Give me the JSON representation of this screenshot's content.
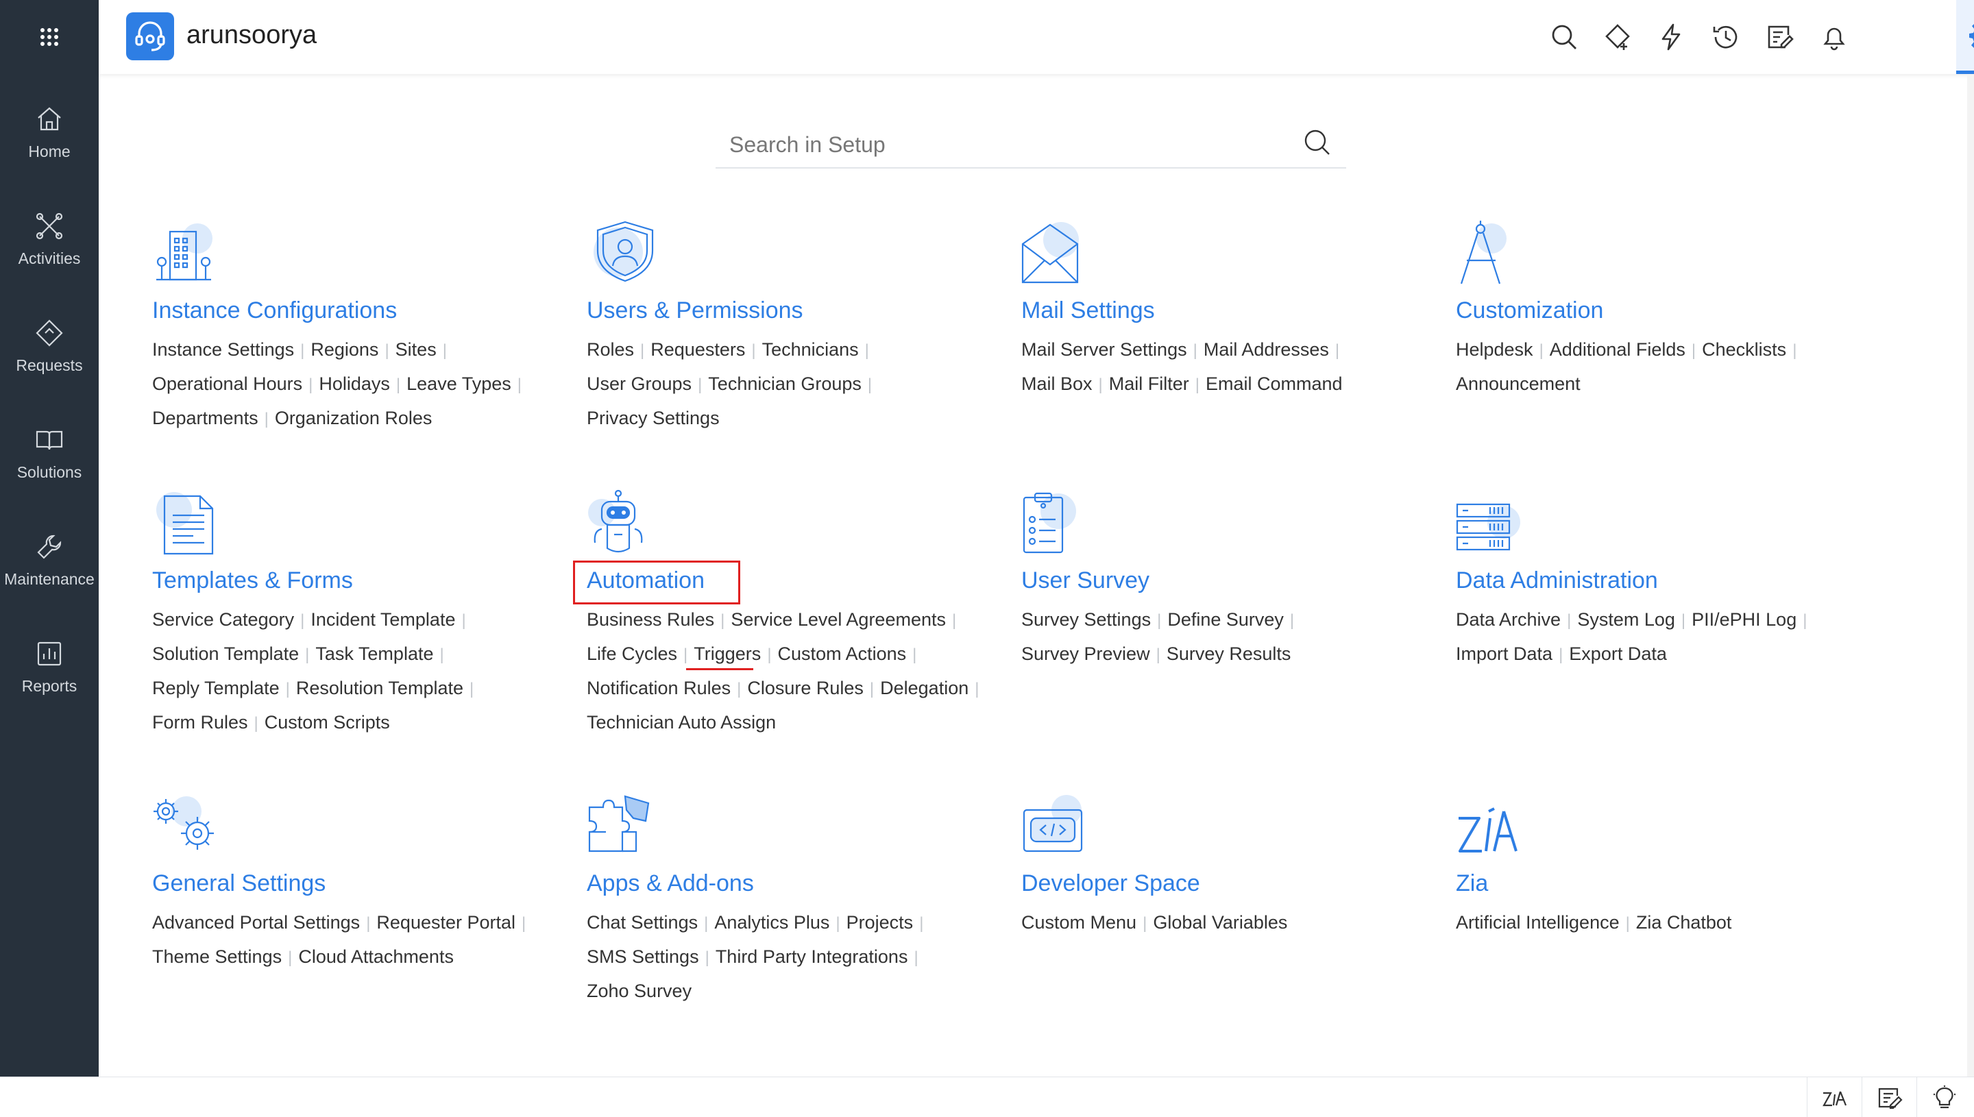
{
  "app": {
    "brand": "arunsoorya"
  },
  "sidebar": {
    "items": [
      {
        "label": "Home"
      },
      {
        "label": "Activities"
      },
      {
        "label": "Requests"
      },
      {
        "label": "Solutions"
      },
      {
        "label": "Maintenance"
      },
      {
        "label": "Reports"
      }
    ]
  },
  "search": {
    "placeholder": "Search in Setup"
  },
  "colors": {
    "accent": "#2e7ee4",
    "sidebar": "#27313c",
    "highlight": "#e02020"
  },
  "sections": {
    "instance": {
      "title": "Instance Configurations",
      "lines": [
        [
          "Instance Settings",
          "Regions",
          "Sites"
        ],
        [
          "Operational Hours",
          "Holidays",
          "Leave Types"
        ],
        [
          "Departments",
          "Organization Roles"
        ]
      ]
    },
    "users": {
      "title": "Users & Permissions",
      "lines": [
        [
          "Roles",
          "Requesters",
          "Technicians"
        ],
        [
          "User Groups",
          "Technician Groups"
        ],
        [
          "Privacy Settings"
        ]
      ]
    },
    "mail": {
      "title": "Mail Settings",
      "lines": [
        [
          "Mail Server Settings",
          "Mail Addresses"
        ],
        [
          "Mail Box",
          "Mail Filter",
          "Email Command"
        ]
      ]
    },
    "custom": {
      "title": "Customization",
      "lines": [
        [
          "Helpdesk",
          "Additional Fields",
          "Checklists"
        ],
        [
          "Announcement"
        ]
      ]
    },
    "templates": {
      "title": "Templates & Forms",
      "lines": [
        [
          "Service Category",
          "Incident Template"
        ],
        [
          "Solution Template",
          "Task Template"
        ],
        [
          "Reply Template",
          "Resolution Template"
        ],
        [
          "Form Rules",
          "Custom Scripts"
        ]
      ]
    },
    "automation": {
      "title": "Automation",
      "lines": [
        [
          "Business Rules",
          "Service Level Agreements"
        ],
        [
          "Life Cycles",
          "Triggers",
          "Custom Actions"
        ],
        [
          "Notification Rules",
          "Closure Rules",
          "Delegation"
        ],
        [
          "Technician Auto Assign"
        ]
      ]
    },
    "survey": {
      "title": "User Survey",
      "lines": [
        [
          "Survey Settings",
          "Define Survey"
        ],
        [
          "Survey Preview",
          "Survey Results"
        ]
      ]
    },
    "data": {
      "title": "Data Administration",
      "lines": [
        [
          "Data Archive",
          "System Log",
          "PII/ePHI Log"
        ],
        [
          "Import Data",
          "Export Data"
        ]
      ]
    },
    "general": {
      "title": "General Settings",
      "lines": [
        [
          "Advanced Portal Settings",
          "Requester Portal"
        ],
        [
          "Theme Settings",
          "Cloud Attachments"
        ]
      ]
    },
    "apps": {
      "title": "Apps & Add-ons",
      "lines": [
        [
          "Chat Settings",
          "Analytics Plus",
          "Projects"
        ],
        [
          "SMS Settings",
          "Third Party Integrations"
        ],
        [
          "Zoho Survey"
        ]
      ]
    },
    "dev": {
      "title": "Developer Space",
      "lines": [
        [
          "Custom Menu",
          "Global Variables"
        ]
      ]
    },
    "zia": {
      "title": "Zia",
      "lines": [
        [
          "Artificial Intelligence",
          "Zia Chatbot"
        ]
      ]
    }
  }
}
